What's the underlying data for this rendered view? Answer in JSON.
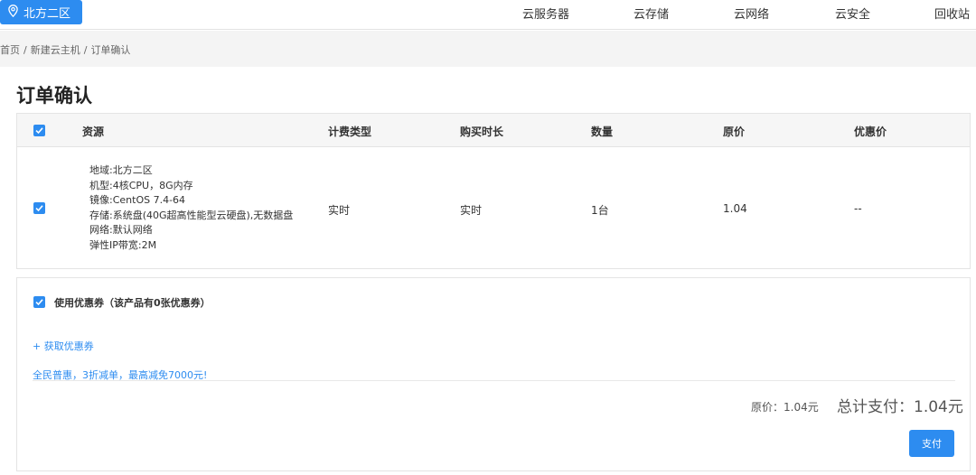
{
  "header": {
    "region_label": "北方二区",
    "nav": [
      "云服务器",
      "云存储",
      "云网络",
      "云安全",
      "回收站"
    ]
  },
  "breadcrumb": {
    "items": [
      "首页",
      "新建云主机",
      "订单确认"
    ],
    "separator": "/"
  },
  "page_title": "订单确认",
  "table": {
    "columns": [
      "资源",
      "计费类型",
      "购买时长",
      "数量",
      "原价",
      "优惠价"
    ],
    "row": {
      "resource_lines": [
        "地域:北方二区",
        "机型:4核CPU，8G内存",
        "镜像:CentOS 7.4-64",
        "存储:系统盘(40G超高性能型云硬盘),无数据盘",
        "网络:默认网络",
        "弹性IP带宽:2M"
      ],
      "billing_type": "实时",
      "duration": "实时",
      "quantity": "1台",
      "original_price": "1.04",
      "discount_price": "--"
    }
  },
  "coupon": {
    "use_label": "使用优惠券（该产品有0张优惠券）",
    "get_link": "+ 获取优惠券",
    "promo_text": "全民普惠，3折减单，最高减免7000元!"
  },
  "summary": {
    "original_price": "原价：1.04元",
    "total_pay": "总计支付：1.04元",
    "pay_button": "支付"
  },
  "colors": {
    "accent": "#2d8cf0"
  }
}
